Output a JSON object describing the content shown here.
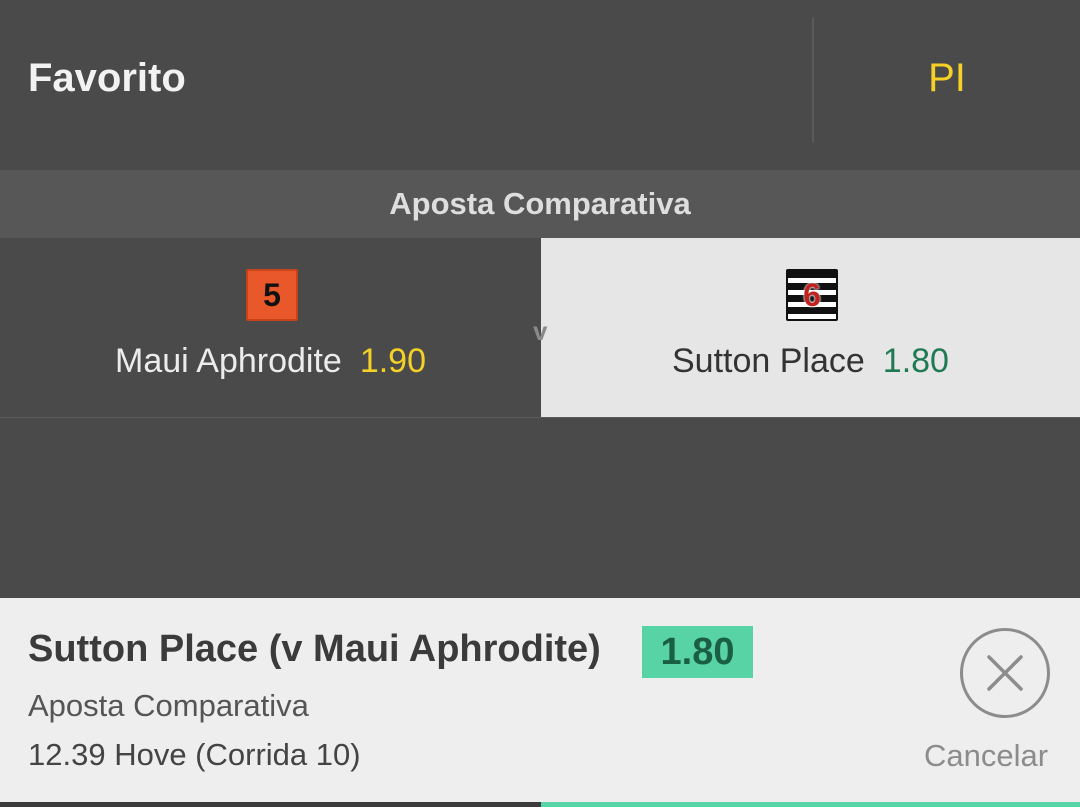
{
  "header": {
    "title": "Favorito",
    "pl_label": "PI"
  },
  "section": {
    "title": "Aposta Comparativa"
  },
  "selection": {
    "vs_label": "v",
    "runners": [
      {
        "saddle_number": "5",
        "name": "Maui Aphrodite",
        "odds": "1.90",
        "selected": false,
        "saddle_color": "#e9582a"
      },
      {
        "saddle_number": "6",
        "name": "Sutton Place",
        "odds": "1.80",
        "selected": true,
        "saddle_color": "black-white-stripes"
      }
    ]
  },
  "bet_slip": {
    "title": "Sutton Place (v Maui Aphrodite)",
    "odds": "1.80",
    "market": "Aposta Comparativa",
    "race": "12.39 Hove (Corrida 10)",
    "cancel_label": "Cancelar",
    "cancel_icon": "close-icon"
  },
  "colors": {
    "background": "#4a4a4a",
    "accent_yellow": "#f5d027",
    "accent_green": "#57d3a6",
    "selected_bg": "#e6e6e6"
  }
}
